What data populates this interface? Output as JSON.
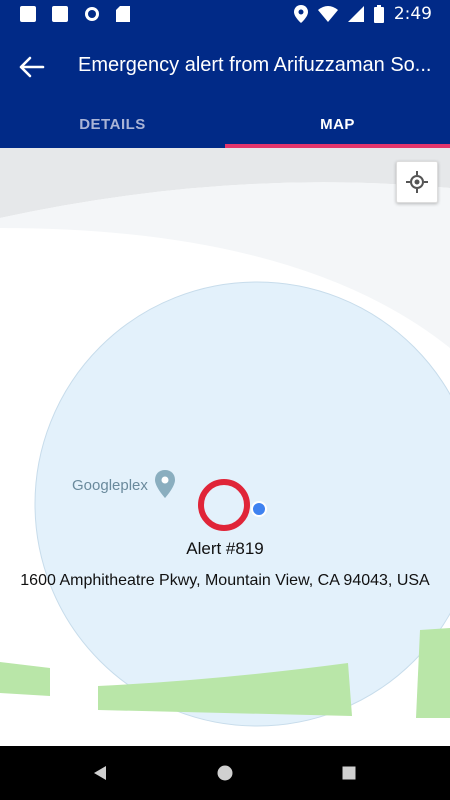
{
  "status_bar": {
    "time": "2:49"
  },
  "header": {
    "title": "Emergency alert from Arifuzzaman So..."
  },
  "tabs": [
    {
      "label": "DETAILS"
    },
    {
      "label": "MAP"
    }
  ],
  "map": {
    "poi_label": "Googleplex",
    "alert": {
      "name": "Alert #819",
      "address": "1600 Amphitheatre Pkwy, Mountain View, CA 94043, USA"
    }
  },
  "colors": {
    "app_bar": "#012a87",
    "tab_indicator": "#e3356b",
    "alert_ring": "#e02538",
    "radius_fill": "#e3f1fb",
    "green_area": "#b9e6a8"
  }
}
